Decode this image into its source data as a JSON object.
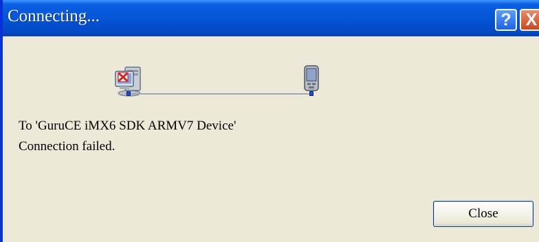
{
  "window": {
    "title": "Connecting...",
    "help_glyph": "?",
    "close_glyph": "X"
  },
  "icons": {
    "computer": "computer-error-icon",
    "device": "pda-device-icon"
  },
  "message": {
    "line1": "To 'GuruCE iMX6 SDK ARMV7 Device'",
    "line2": "Connection failed."
  },
  "buttons": {
    "close_label": "Close"
  },
  "colors": {
    "titlebar": "#0655d8",
    "body": "#ece9d8",
    "error": "#d4261c"
  }
}
